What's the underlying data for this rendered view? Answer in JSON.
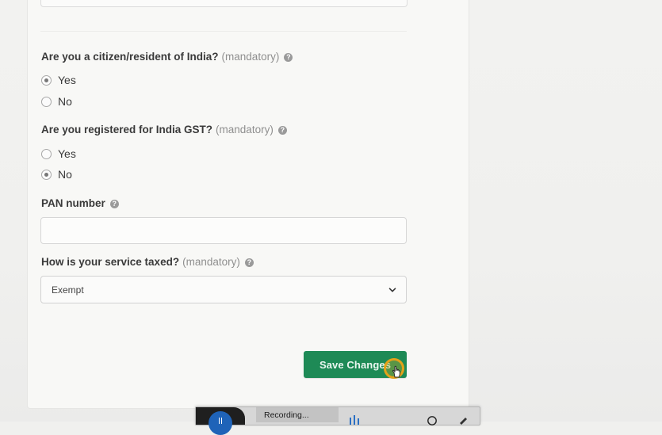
{
  "form": {
    "citizen": {
      "question": "Are you a citizen/resident of India?",
      "mandatory": "(mandatory)",
      "options": [
        "Yes",
        "No"
      ],
      "selected": "Yes"
    },
    "gst": {
      "question": "Are you registered for India GST?",
      "mandatory": "(mandatory)",
      "options": [
        "Yes",
        "No"
      ],
      "selected": "No"
    },
    "pan": {
      "label": "PAN number",
      "value": ""
    },
    "service_tax": {
      "question": "How is your service taxed?",
      "mandatory": "(mandatory)",
      "selected": "Exempt"
    },
    "save_label": "Save Changes",
    "help_glyph": "?"
  },
  "recorder": {
    "status": "Recording..."
  },
  "colors": {
    "accent": "#1e8a56",
    "page": "#f0f0ee",
    "recorder_button": "#1f63b8"
  },
  "icons": [
    "help-icon",
    "chevron-down-icon",
    "pause-icon",
    "audio-wave-icon",
    "hand-cursor-icon"
  ]
}
